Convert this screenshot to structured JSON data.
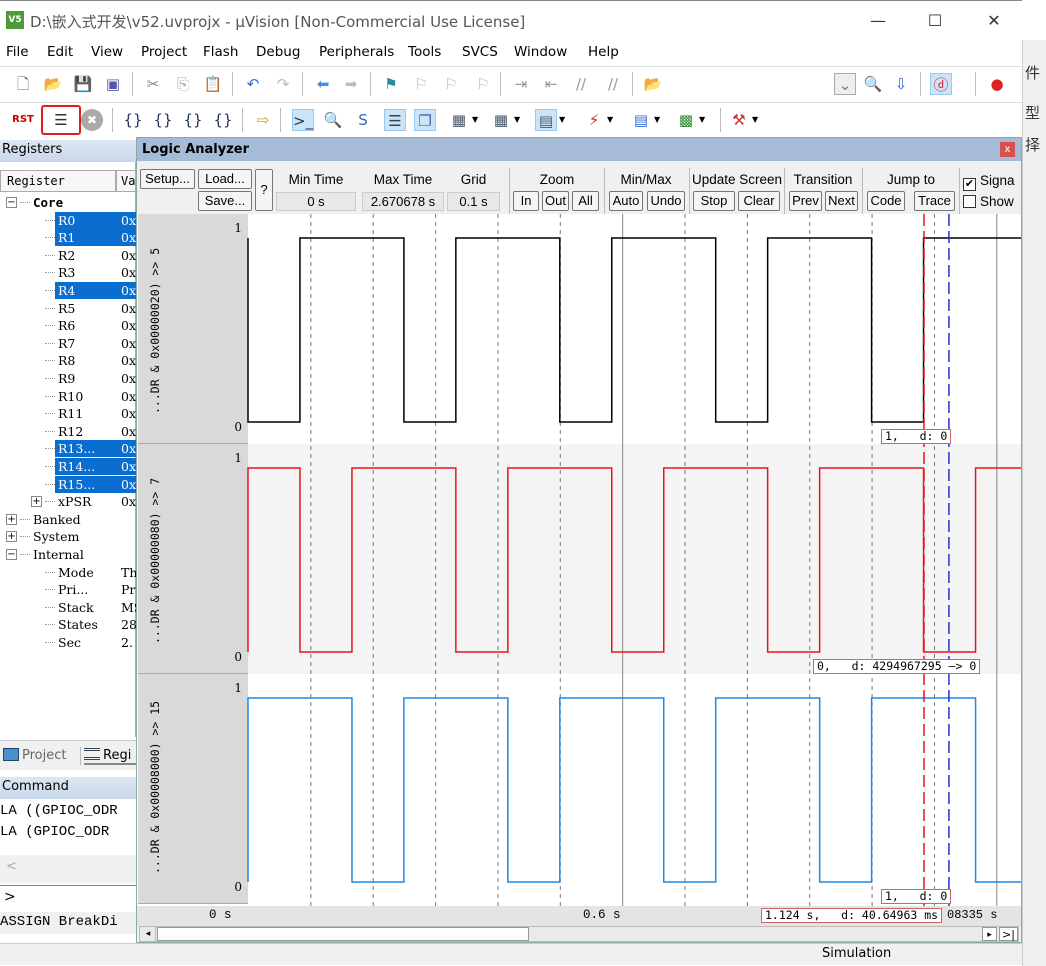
{
  "window": {
    "title": "D:\\嵌入式开发\\v52.uvprojx - µVision  [Non-Commercial Use License]",
    "app_icon": "V5",
    "minimize": "—",
    "maximize": "☐",
    "close": "✕"
  },
  "menu": [
    "File",
    "Edit",
    "View",
    "Project",
    "Flash",
    "Debug",
    "Peripherals",
    "Tools",
    "SVCS",
    "Window",
    "Help"
  ],
  "toolbar1_icons": [
    "new-file-icon",
    "open-folder-icon",
    "save-icon",
    "save-all-icon",
    "cut-icon",
    "copy-icon",
    "paste-icon",
    "undo-icon",
    "redo-icon",
    "navigate-back-icon",
    "navigate-forward-icon",
    "bookmark-icon",
    "prev-bookmark-icon",
    "next-bookmark-icon",
    "clear-bookmarks-icon",
    "indent-icon",
    "unindent-icon",
    "comment-icon",
    "uncomment-icon",
    "find-in-files-icon",
    "dropdown-combo",
    "find-icon",
    "debug-settings-icon",
    "start-debug-icon",
    "breakpoint-icon"
  ],
  "toolbar2_icons": [
    "reset-icon",
    "run-icon",
    "stop-icon",
    "step-into-icon",
    "step-over-icon",
    "step-out-icon",
    "run-to-cursor-icon",
    "show-next-statement-icon",
    "command-window-icon",
    "disassembly-window-icon",
    "symbols-window-icon",
    "registers-window-icon",
    "call-stack-icon",
    "watch-window-icon",
    "memory-window-icon",
    "serial-window-icon",
    "analysis-window-icon",
    "trace-window-icon",
    "system-viewer-icon",
    "toolbox-icon"
  ],
  "toolbar2_labels": {
    "reset": "RST"
  },
  "registers": {
    "title": "Registers",
    "columns": [
      "Register",
      "Va"
    ],
    "rows": [
      {
        "name": "Core",
        "value": "",
        "level": 0,
        "expander": "−",
        "bold": true,
        "selected": false
      },
      {
        "name": "R0",
        "value": "0x",
        "level": 2,
        "selected": true
      },
      {
        "name": "R1",
        "value": "0x",
        "level": 2,
        "selected": true
      },
      {
        "name": "R2",
        "value": "0x",
        "level": 2,
        "selected": false
      },
      {
        "name": "R3",
        "value": "0x",
        "level": 2,
        "selected": false
      },
      {
        "name": "R4",
        "value": "0x",
        "level": 2,
        "selected": true
      },
      {
        "name": "R5",
        "value": "0x",
        "level": 2,
        "selected": false
      },
      {
        "name": "R6",
        "value": "0x",
        "level": 2,
        "selected": false
      },
      {
        "name": "R7",
        "value": "0x",
        "level": 2,
        "selected": false
      },
      {
        "name": "R8",
        "value": "0x",
        "level": 2,
        "selected": false
      },
      {
        "name": "R9",
        "value": "0x",
        "level": 2,
        "selected": false
      },
      {
        "name": "R10",
        "value": "0x",
        "level": 2,
        "selected": false
      },
      {
        "name": "R11",
        "value": "0x",
        "level": 2,
        "selected": false
      },
      {
        "name": "R12",
        "value": "0x",
        "level": 2,
        "selected": false
      },
      {
        "name": "R13...",
        "value": "0x",
        "level": 2,
        "selected": true
      },
      {
        "name": "R14...",
        "value": "0x",
        "level": 2,
        "selected": true
      },
      {
        "name": "R15...",
        "value": "0x",
        "level": 2,
        "selected": true
      },
      {
        "name": "xPSR",
        "value": "0x",
        "level": 1,
        "expander": "+",
        "selected": false
      },
      {
        "name": "Banked",
        "value": "",
        "level": 0,
        "expander": "+",
        "selected": false
      },
      {
        "name": "System",
        "value": "",
        "level": 0,
        "expander": "+",
        "selected": false
      },
      {
        "name": "Internal",
        "value": "",
        "level": 0,
        "expander": "−",
        "selected": false
      },
      {
        "name": "Mode",
        "value": "Th",
        "level": 1,
        "selected": false
      },
      {
        "name": "Pri...",
        "value": "Pr",
        "level": 1,
        "selected": false
      },
      {
        "name": "Stack",
        "value": "MS",
        "level": 1,
        "selected": false
      },
      {
        "name": "States",
        "value": "28",
        "level": 1,
        "selected": false
      },
      {
        "name": "Sec",
        "value": "2.",
        "level": 1,
        "selected": false
      }
    ]
  },
  "panel_tabs": [
    {
      "label": "Project",
      "active": false
    },
    {
      "label": "Regi",
      "active": true
    }
  ],
  "command": {
    "title": "Command",
    "lines": [
      "LA ((GPIOC_ODR",
      "LA (GPIOC_ODR "
    ],
    "scroll_left": "<",
    "prompt": ">",
    "input_value": "",
    "hint": "ASSIGN BreakDi"
  },
  "logic_analyzer": {
    "title": "Logic Analyzer",
    "close": "x",
    "buttons": {
      "setup": "Setup...",
      "load": "Load...",
      "save": "Save...",
      "help": "?"
    },
    "min_time": {
      "label": "Min Time",
      "value": "0 s"
    },
    "max_time": {
      "label": "Max Time",
      "value": "2.670678 s"
    },
    "grid": {
      "label": "Grid",
      "value": "0.1 s"
    },
    "zoom": {
      "label": "Zoom",
      "in": "In",
      "out": "Out",
      "all": "All"
    },
    "minmax": {
      "label": "Min/Max",
      "auto": "Auto",
      "undo": "Undo"
    },
    "update_screen": {
      "label": "Update Screen",
      "stop": "Stop",
      "clear": "Clear"
    },
    "transition": {
      "label": "Transition",
      "prev": "Prev",
      "next": "Next"
    },
    "jump_to": {
      "label": "Jump to",
      "code": "Code",
      "trace": "Trace"
    },
    "checkboxes": [
      {
        "label": "Signa",
        "checked": true
      },
      {
        "label": "Show",
        "checked": false
      }
    ],
    "signals": [
      {
        "name": "...DR & 0x00000020) >> 5",
        "color": "#000000",
        "high_label": "1",
        "low_label": "0",
        "initial": 0,
        "transitions_s": [
          0.0833,
          0.25,
          0.3333,
          0.5,
          0.5833,
          0.75,
          0.8333,
          1.0,
          1.0833
        ],
        "cursor_info": "1,   d: 0"
      },
      {
        "name": "...DR & 0x00000080) >> 7",
        "color": "#e8141b",
        "high_label": "1",
        "low_label": "0",
        "initial": 1,
        "transitions_s": [
          0.0833,
          0.1667,
          0.3333,
          0.4167,
          0.5833,
          0.6667,
          0.8333,
          0.9167,
          1.0833,
          1.1667
        ],
        "cursor_info": "0,   d: 4294967295 —> 0"
      },
      {
        "name": "...DR & 0x00008000) >> 15",
        "color": "#1e88e5",
        "high_label": "1",
        "low_label": "0",
        "initial": 1,
        "transitions_s": [
          0.1667,
          0.25,
          0.4167,
          0.5,
          0.6667,
          0.75,
          0.9167,
          1.0,
          1.1667
        ],
        "cursor_info": "1,   d: 0"
      }
    ],
    "time_axis": {
      "view_range_s": [
        0,
        1.238
      ],
      "grid_s": 0.1,
      "labels": [
        {
          "t": 0,
          "text": "0 s"
        },
        {
          "t": 0.6,
          "text": "0.6 s"
        }
      ]
    },
    "cursors": {
      "red_s": 1.084,
      "blue_s": 1.124,
      "red_color": "#e8141b",
      "blue_color": "#2233cc",
      "readout": "1.124 s,   d: 40.64963 ms",
      "end_readout": "08335 s"
    },
    "scroll": {
      "left": "◂",
      "right": "▸",
      "end": ">|"
    }
  },
  "status": {
    "mode": "Simulation"
  },
  "right_strip_chars": [
    "件",
    "型",
    "择"
  ]
}
